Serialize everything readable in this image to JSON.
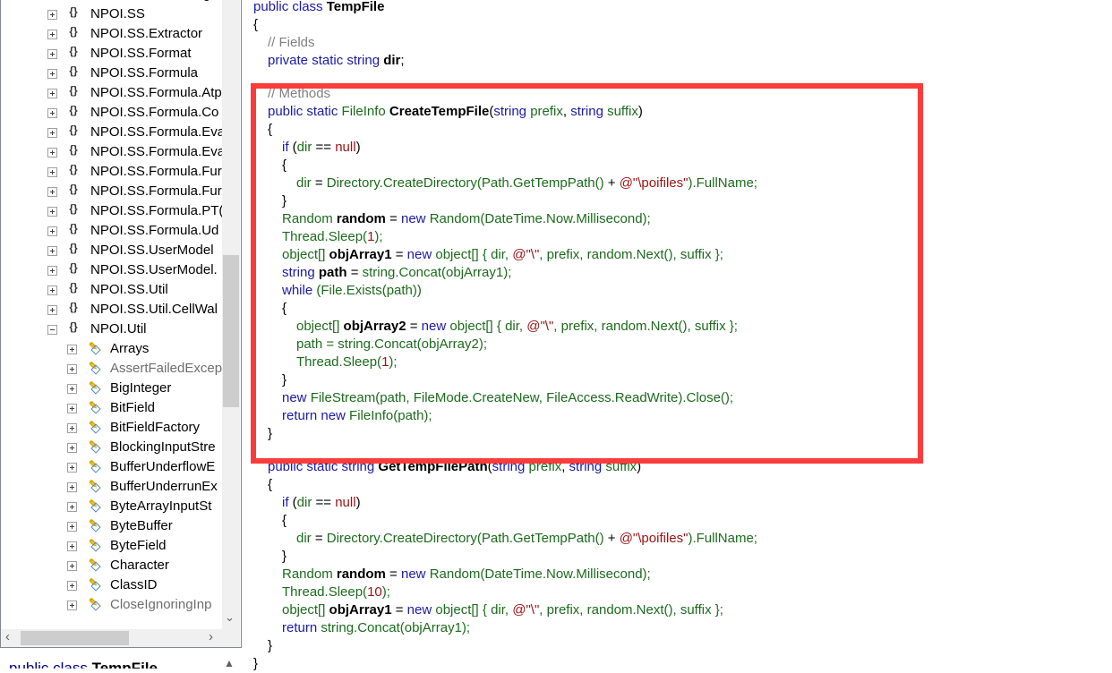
{
  "tree": {
    "items": [
      {
        "label": "NPOI.POIFS.Storage",
        "kind": "ns",
        "level": 0,
        "expander": "plus"
      },
      {
        "label": "NPOI.SS",
        "kind": "ns",
        "level": 0,
        "expander": "plus"
      },
      {
        "label": "NPOI.SS.Extractor",
        "kind": "ns",
        "level": 0,
        "expander": "plus"
      },
      {
        "label": "NPOI.SS.Format",
        "kind": "ns",
        "level": 0,
        "expander": "plus"
      },
      {
        "label": "NPOI.SS.Formula",
        "kind": "ns",
        "level": 0,
        "expander": "plus"
      },
      {
        "label": "NPOI.SS.Formula.Atp",
        "kind": "ns",
        "level": 0,
        "expander": "plus"
      },
      {
        "label": "NPOI.SS.Formula.Co",
        "kind": "ns",
        "level": 0,
        "expander": "plus"
      },
      {
        "label": "NPOI.SS.Formula.Eva",
        "kind": "ns",
        "level": 0,
        "expander": "plus"
      },
      {
        "label": "NPOI.SS.Formula.Eva",
        "kind": "ns",
        "level": 0,
        "expander": "plus"
      },
      {
        "label": "NPOI.SS.Formula.Fur",
        "kind": "ns",
        "level": 0,
        "expander": "plus"
      },
      {
        "label": "NPOI.SS.Formula.Fur",
        "kind": "ns",
        "level": 0,
        "expander": "plus"
      },
      {
        "label": "NPOI.SS.Formula.PT(",
        "kind": "ns",
        "level": 0,
        "expander": "plus"
      },
      {
        "label": "NPOI.SS.Formula.Ud",
        "kind": "ns",
        "level": 0,
        "expander": "plus"
      },
      {
        "label": "NPOI.SS.UserModel",
        "kind": "ns",
        "level": 0,
        "expander": "plus"
      },
      {
        "label": "NPOI.SS.UserModel.",
        "kind": "ns",
        "level": 0,
        "expander": "plus"
      },
      {
        "label": "NPOI.SS.Util",
        "kind": "ns",
        "level": 0,
        "expander": "plus"
      },
      {
        "label": "NPOI.SS.Util.CellWal",
        "kind": "ns",
        "level": 0,
        "expander": "plus"
      },
      {
        "label": "NPOI.Util",
        "kind": "ns",
        "level": 0,
        "expander": "minus"
      },
      {
        "label": "Arrays",
        "kind": "cls",
        "level": 1,
        "expander": "plus"
      },
      {
        "label": "AssertFailedExcep",
        "kind": "cls",
        "level": 1,
        "expander": "plus",
        "dim": true
      },
      {
        "label": "BigInteger",
        "kind": "cls",
        "level": 1,
        "expander": "plus"
      },
      {
        "label": "BitField",
        "kind": "cls",
        "level": 1,
        "expander": "plus"
      },
      {
        "label": "BitFieldFactory",
        "kind": "cls",
        "level": 1,
        "expander": "plus"
      },
      {
        "label": "BlockingInputStre",
        "kind": "cls",
        "level": 1,
        "expander": "plus"
      },
      {
        "label": "BufferUnderflowE",
        "kind": "cls",
        "level": 1,
        "expander": "plus"
      },
      {
        "label": "BufferUnderrunEx",
        "kind": "cls",
        "level": 1,
        "expander": "plus"
      },
      {
        "label": "ByteArrayInputSt",
        "kind": "cls",
        "level": 1,
        "expander": "plus"
      },
      {
        "label": "ByteBuffer",
        "kind": "cls",
        "level": 1,
        "expander": "plus"
      },
      {
        "label": "ByteField",
        "kind": "cls",
        "level": 1,
        "expander": "plus"
      },
      {
        "label": "Character",
        "kind": "cls",
        "level": 1,
        "expander": "plus"
      },
      {
        "label": "ClassID",
        "kind": "cls",
        "level": 1,
        "expander": "plus"
      },
      {
        "label": "CloseIgnoringInp",
        "kind": "cls",
        "level": 1,
        "expander": "plus",
        "dim": true
      }
    ]
  },
  "bottom_pane": {
    "keyword": "public class ",
    "name": "TempFile"
  },
  "highlight_color": "#fc3b3b",
  "code": [
    {
      "indent": 0,
      "tokens": [
        [
          "public class ",
          "kw"
        ],
        [
          "TempFile",
          "bd"
        ]
      ]
    },
    {
      "indent": 0,
      "tokens": [
        [
          "{",
          "tx"
        ]
      ]
    },
    {
      "indent": 1,
      "tokens": [
        [
          "// Fields",
          "cm"
        ]
      ]
    },
    {
      "indent": 1,
      "tokens": [
        [
          "private static string ",
          "kw"
        ],
        [
          "dir",
          "bd"
        ],
        [
          ";",
          "tx"
        ]
      ]
    },
    {
      "indent": 1,
      "gap": true,
      "tokens": [
        [
          "// Methods",
          "cm"
        ]
      ]
    },
    {
      "indent": 1,
      "tokens": [
        [
          "public static ",
          "kw"
        ],
        [
          "FileInfo ",
          "id"
        ],
        [
          "CreateTempFile",
          "bd"
        ],
        [
          "(",
          "tx"
        ],
        [
          "string ",
          "kw"
        ],
        [
          "prefix",
          "id"
        ],
        [
          ", ",
          "tx"
        ],
        [
          "string ",
          "kw"
        ],
        [
          "suffix",
          "id"
        ],
        [
          ")",
          "tx"
        ]
      ]
    },
    {
      "indent": 1,
      "tokens": [
        [
          "{",
          "tx"
        ]
      ]
    },
    {
      "indent": 2,
      "tokens": [
        [
          "if ",
          "kw"
        ],
        [
          "(",
          "tx"
        ],
        [
          "dir",
          "id"
        ],
        [
          " == ",
          "tx"
        ],
        [
          "null",
          "str"
        ],
        [
          ")",
          "tx"
        ]
      ]
    },
    {
      "indent": 2,
      "tokens": [
        [
          "{",
          "tx"
        ]
      ]
    },
    {
      "indent": 3,
      "tokens": [
        [
          "dir",
          "id"
        ],
        [
          " = ",
          "tx"
        ],
        [
          "Directory.CreateDirectory(Path.GetTempPath() ",
          "id"
        ],
        [
          "+ ",
          "tx"
        ],
        [
          "@\"\\poifiles\"",
          "str"
        ],
        [
          ").FullName;",
          "id"
        ]
      ]
    },
    {
      "indent": 2,
      "tokens": [
        [
          "}",
          "tx"
        ]
      ]
    },
    {
      "indent": 2,
      "tokens": [
        [
          "Random ",
          "id"
        ],
        [
          "random",
          "bd"
        ],
        [
          " = ",
          "tx"
        ],
        [
          "new ",
          "kw"
        ],
        [
          "Random(DateTime.Now.Millisecond);",
          "id"
        ]
      ]
    },
    {
      "indent": 2,
      "tokens": [
        [
          "Thread.Sleep(",
          "id"
        ],
        [
          "1",
          "str"
        ],
        [
          ");",
          "id"
        ]
      ]
    },
    {
      "indent": 2,
      "tokens": [
        [
          "object[] ",
          "id"
        ],
        [
          "objArray1",
          "bd"
        ],
        [
          " = ",
          "tx"
        ],
        [
          "new ",
          "kw"
        ],
        [
          "object[] { dir, ",
          "id"
        ],
        [
          "@\"\\\"",
          "str"
        ],
        [
          ", prefix, random.Next(), suffix };",
          "id"
        ]
      ]
    },
    {
      "indent": 2,
      "tokens": [
        [
          "string ",
          "kw"
        ],
        [
          "path",
          "bd"
        ],
        [
          " = ",
          "tx"
        ],
        [
          "string.Concat(objArray1);",
          "id"
        ]
      ]
    },
    {
      "indent": 2,
      "tokens": [
        [
          "while ",
          "kw"
        ],
        [
          "(File.Exists(path))",
          "id"
        ]
      ]
    },
    {
      "indent": 2,
      "tokens": [
        [
          "{",
          "tx"
        ]
      ]
    },
    {
      "indent": 3,
      "tokens": [
        [
          "object[] ",
          "id"
        ],
        [
          "objArray2",
          "bd"
        ],
        [
          " = ",
          "tx"
        ],
        [
          "new ",
          "kw"
        ],
        [
          "object[] { dir, ",
          "id"
        ],
        [
          "@\"\\\"",
          "str"
        ],
        [
          ", prefix, random.Next(), suffix };",
          "id"
        ]
      ]
    },
    {
      "indent": 3,
      "tokens": [
        [
          "path = string.Concat(objArray2);",
          "id"
        ]
      ]
    },
    {
      "indent": 3,
      "tokens": [
        [
          "Thread.Sleep(",
          "id"
        ],
        [
          "1",
          "str"
        ],
        [
          ");",
          "id"
        ]
      ]
    },
    {
      "indent": 2,
      "tokens": [
        [
          "}",
          "tx"
        ]
      ]
    },
    {
      "indent": 2,
      "tokens": [
        [
          "new ",
          "kw"
        ],
        [
          "FileStream(path, FileMode.CreateNew, FileAccess.ReadWrite).Close();",
          "id"
        ]
      ]
    },
    {
      "indent": 2,
      "tokens": [
        [
          "return ",
          "kw"
        ],
        [
          "new ",
          "kw"
        ],
        [
          "FileInfo(path);",
          "id"
        ]
      ]
    },
    {
      "indent": 1,
      "tokens": [
        [
          "}",
          "tx"
        ]
      ]
    },
    {
      "indent": 1,
      "gap": true,
      "tokens": [
        [
          "public static ",
          "kw"
        ],
        [
          "string ",
          "kw"
        ],
        [
          "GetTempFilePath",
          "bd"
        ],
        [
          "(",
          "tx"
        ],
        [
          "string ",
          "kw"
        ],
        [
          "prefix",
          "id"
        ],
        [
          ", ",
          "tx"
        ],
        [
          "string ",
          "kw"
        ],
        [
          "suffix",
          "id"
        ],
        [
          ")",
          "tx"
        ]
      ]
    },
    {
      "indent": 1,
      "tokens": [
        [
          "{",
          "tx"
        ]
      ]
    },
    {
      "indent": 2,
      "tokens": [
        [
          "if ",
          "kw"
        ],
        [
          "(",
          "tx"
        ],
        [
          "dir",
          "id"
        ],
        [
          " == ",
          "tx"
        ],
        [
          "null",
          "str"
        ],
        [
          ")",
          "tx"
        ]
      ]
    },
    {
      "indent": 2,
      "tokens": [
        [
          "{",
          "tx"
        ]
      ]
    },
    {
      "indent": 3,
      "tokens": [
        [
          "dir",
          "id"
        ],
        [
          " = ",
          "tx"
        ],
        [
          "Directory.CreateDirectory(Path.GetTempPath() ",
          "id"
        ],
        [
          "+ ",
          "tx"
        ],
        [
          "@\"\\poifiles\"",
          "str"
        ],
        [
          ").FullName;",
          "id"
        ]
      ]
    },
    {
      "indent": 2,
      "tokens": [
        [
          "}",
          "tx"
        ]
      ]
    },
    {
      "indent": 2,
      "tokens": [
        [
          "Random ",
          "id"
        ],
        [
          "random",
          "bd"
        ],
        [
          " = ",
          "tx"
        ],
        [
          "new ",
          "kw"
        ],
        [
          "Random(DateTime.Now.Millisecond);",
          "id"
        ]
      ]
    },
    {
      "indent": 2,
      "tokens": [
        [
          "Thread.Sleep(",
          "id"
        ],
        [
          "10",
          "str"
        ],
        [
          ");",
          "id"
        ]
      ]
    },
    {
      "indent": 2,
      "tokens": [
        [
          "object[] ",
          "id"
        ],
        [
          "objArray1",
          "bd"
        ],
        [
          " = ",
          "tx"
        ],
        [
          "new ",
          "kw"
        ],
        [
          "object[] { dir, ",
          "id"
        ],
        [
          "@\"\\\"",
          "str"
        ],
        [
          ", prefix, random.Next(), suffix };",
          "id"
        ]
      ]
    },
    {
      "indent": 2,
      "tokens": [
        [
          "return ",
          "kw"
        ],
        [
          "string.Concat(objArray1);",
          "id"
        ]
      ]
    },
    {
      "indent": 1,
      "tokens": [
        [
          "}",
          "tx"
        ]
      ]
    },
    {
      "indent": 0,
      "tokens": [
        [
          "}",
          "tx"
        ]
      ]
    }
  ]
}
